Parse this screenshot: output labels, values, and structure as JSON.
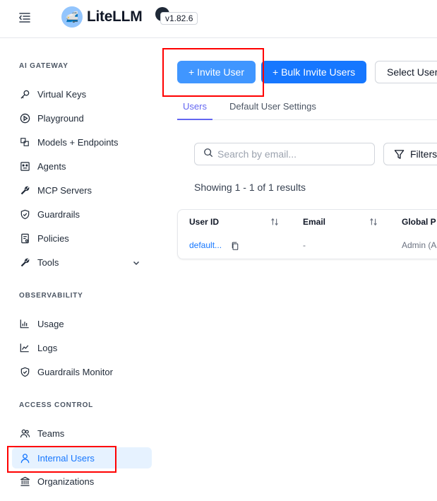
{
  "header": {
    "brand": "LiteLLM",
    "logo_emoji": "🚅",
    "version": "v1.82.6"
  },
  "sidebar": {
    "sections": [
      {
        "title": "AI GATEWAY",
        "items": [
          {
            "label": "Virtual Keys",
            "icon": "key-icon"
          },
          {
            "label": "Playground",
            "icon": "play-circle-icon"
          },
          {
            "label": "Models + Endpoints",
            "icon": "block-icon"
          },
          {
            "label": "Agents",
            "icon": "robot-icon"
          },
          {
            "label": "MCP Servers",
            "icon": "tool-icon"
          },
          {
            "label": "Guardrails",
            "icon": "safety-icon"
          },
          {
            "label": "Policies",
            "icon": "audit-icon"
          },
          {
            "label": "Tools",
            "icon": "tool-icon",
            "expandable": true
          }
        ]
      },
      {
        "title": "OBSERVABILITY",
        "items": [
          {
            "label": "Usage",
            "icon": "bar-chart-icon"
          },
          {
            "label": "Logs",
            "icon": "line-chart-icon"
          },
          {
            "label": "Guardrails Monitor",
            "icon": "safety-icon"
          }
        ]
      },
      {
        "title": "ACCESS CONTROL",
        "items": [
          {
            "label": "Teams",
            "icon": "team-icon"
          },
          {
            "label": "Internal Users",
            "icon": "user-icon",
            "active": true
          },
          {
            "label": "Organizations",
            "icon": "bank-icon"
          }
        ]
      }
    ]
  },
  "main": {
    "buttons": {
      "invite": "+ Invite User",
      "bulk_invite": "+ Bulk Invite Users",
      "select": "Select User"
    },
    "tabs": [
      {
        "label": "Users",
        "active": true
      },
      {
        "label": "Default User Settings",
        "active": false
      }
    ],
    "search": {
      "placeholder": "Search by email...",
      "value": ""
    },
    "filters_label": "Filters",
    "results_text": "Showing 1 - 1 of 1 results",
    "table": {
      "columns": [
        "User ID",
        "Email",
        "Global P"
      ],
      "rows": [
        {
          "user_id": "default...",
          "email": "-",
          "global_proxy_role": "Admin (A"
        }
      ]
    }
  },
  "colors": {
    "primary": "#1677ff",
    "primary_light": "#4096ff",
    "tab_active": "#6366f1",
    "active_nav_bg": "#e6f2ff",
    "highlight": "#ff0000"
  }
}
